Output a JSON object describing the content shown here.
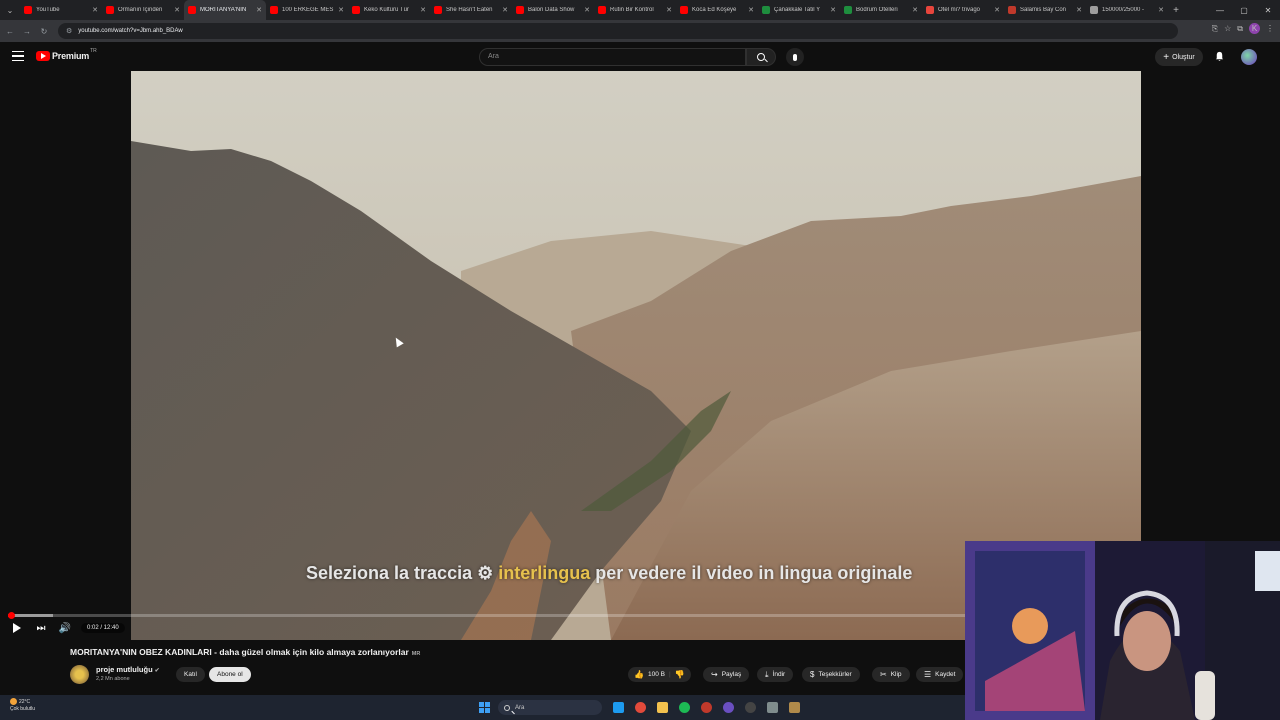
{
  "browser": {
    "tabs": [
      {
        "label": "YouTube",
        "color": "#ff0000"
      },
      {
        "label": "Ormanın İçinden",
        "color": "#ff0000"
      },
      {
        "label": "MORITANYA'NIN",
        "color": "#ff0000",
        "active": true
      },
      {
        "label": "100 ERKEĞE MES",
        "color": "#ff0000"
      },
      {
        "label": "Keko Kültürü Tür",
        "color": "#ff0000"
      },
      {
        "label": "She Hasn't Eaten",
        "color": "#ff0000"
      },
      {
        "label": "Balon Data Show",
        "color": "#ff0000"
      },
      {
        "label": "Rutin Bir Kontrol",
        "color": "#ff0000"
      },
      {
        "label": "Koca Ed Köşeye",
        "color": "#ff0000"
      },
      {
        "label": "Çanakkale Tatil Y",
        "color": "#1e8e3e"
      },
      {
        "label": "Bodrum Otelleri",
        "color": "#1e8e3e"
      },
      {
        "label": "Otel mi? trivago",
        "color": "#e8453c"
      },
      {
        "label": "Salamis Bay Con",
        "color": "#c0392b"
      },
      {
        "label": "150000/25000 -",
        "color": "#9e9e9e"
      }
    ],
    "url": "youtube.com/watch?v=Jbm.ahb_BDAw",
    "profile_initial": "K"
  },
  "youtube": {
    "logo_word": "Premium",
    "logo_region": "TR",
    "search_placeholder": "Ara",
    "create_label": "Oluştur"
  },
  "video": {
    "subtitle_before": "Seleziona la traccia ",
    "subtitle_gear": "⚙",
    "subtitle_highlight": "interlingua",
    "subtitle_after": " per vedere il video in lingua originale",
    "time_display": "0:02 / 12:40",
    "progress_fraction": 0.0026,
    "buffered_fraction": 0.04
  },
  "info": {
    "title": "MORITANYA'NIN OBEZ KADINLARI - daha güzel olmak için kilo almaya zorlanıyorlar",
    "title_suffix": "MR",
    "channel_name": "proje mutluluğu",
    "verified_mark": "✔",
    "subscribers": "2,2 Mn abone",
    "join_label": "Katıl",
    "subscribe_label": "Abone ol",
    "actions": {
      "like_count": "100 B",
      "share": "Paylaş",
      "download": "İndir",
      "thanks": "Teşekkürler",
      "clip": "Klip",
      "save": "Kaydet"
    }
  },
  "taskbar": {
    "temperature": "22°C",
    "weather_text": "Çok bulutlu",
    "search_label": "Ara"
  }
}
